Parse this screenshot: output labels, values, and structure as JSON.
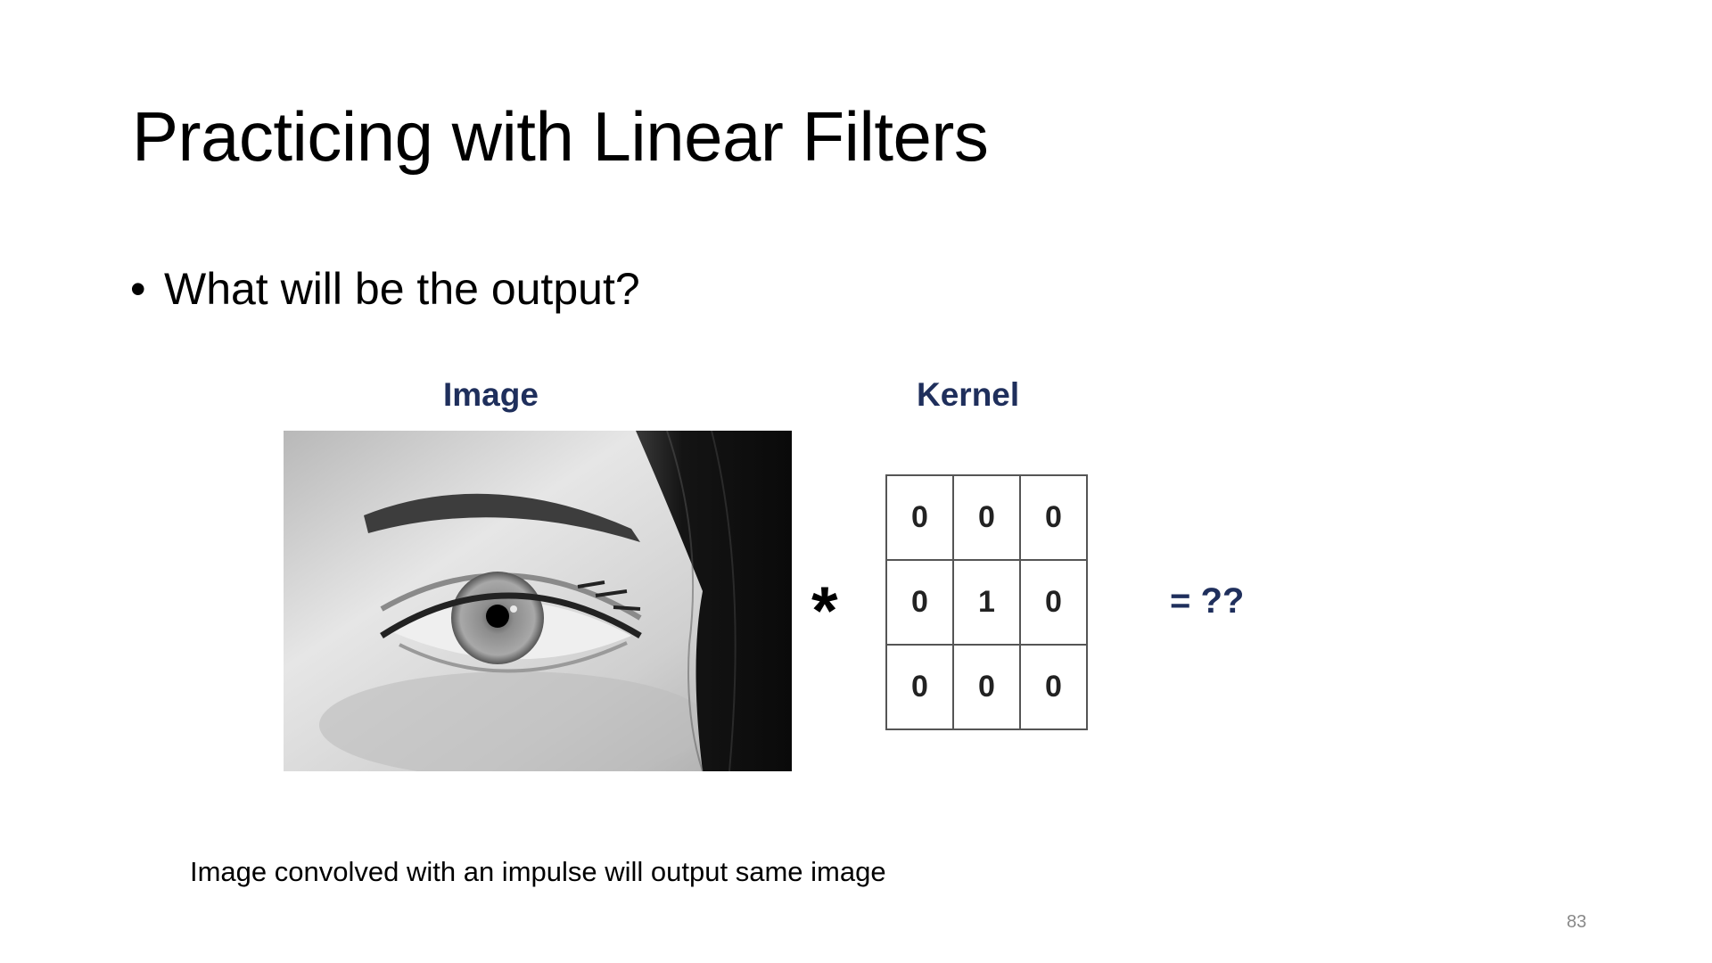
{
  "slide": {
    "title": "Practicing with Linear Filters",
    "bullet": "What will be the output?",
    "bullet_marker": "•",
    "image_label": "Image",
    "kernel_label": "Kernel",
    "operator": "*",
    "result": "= ??",
    "kernel": [
      [
        "0",
        "0",
        "0"
      ],
      [
        "0",
        "1",
        "0"
      ],
      [
        "0",
        "0",
        "0"
      ]
    ],
    "caption": "Image convolved with an impulse will output same image",
    "page_number": "83"
  },
  "colors": {
    "label_navy": "#1f2f5c",
    "grid_border": "#555555"
  },
  "icons": {
    "photo": "grayscale-eye-photo"
  }
}
